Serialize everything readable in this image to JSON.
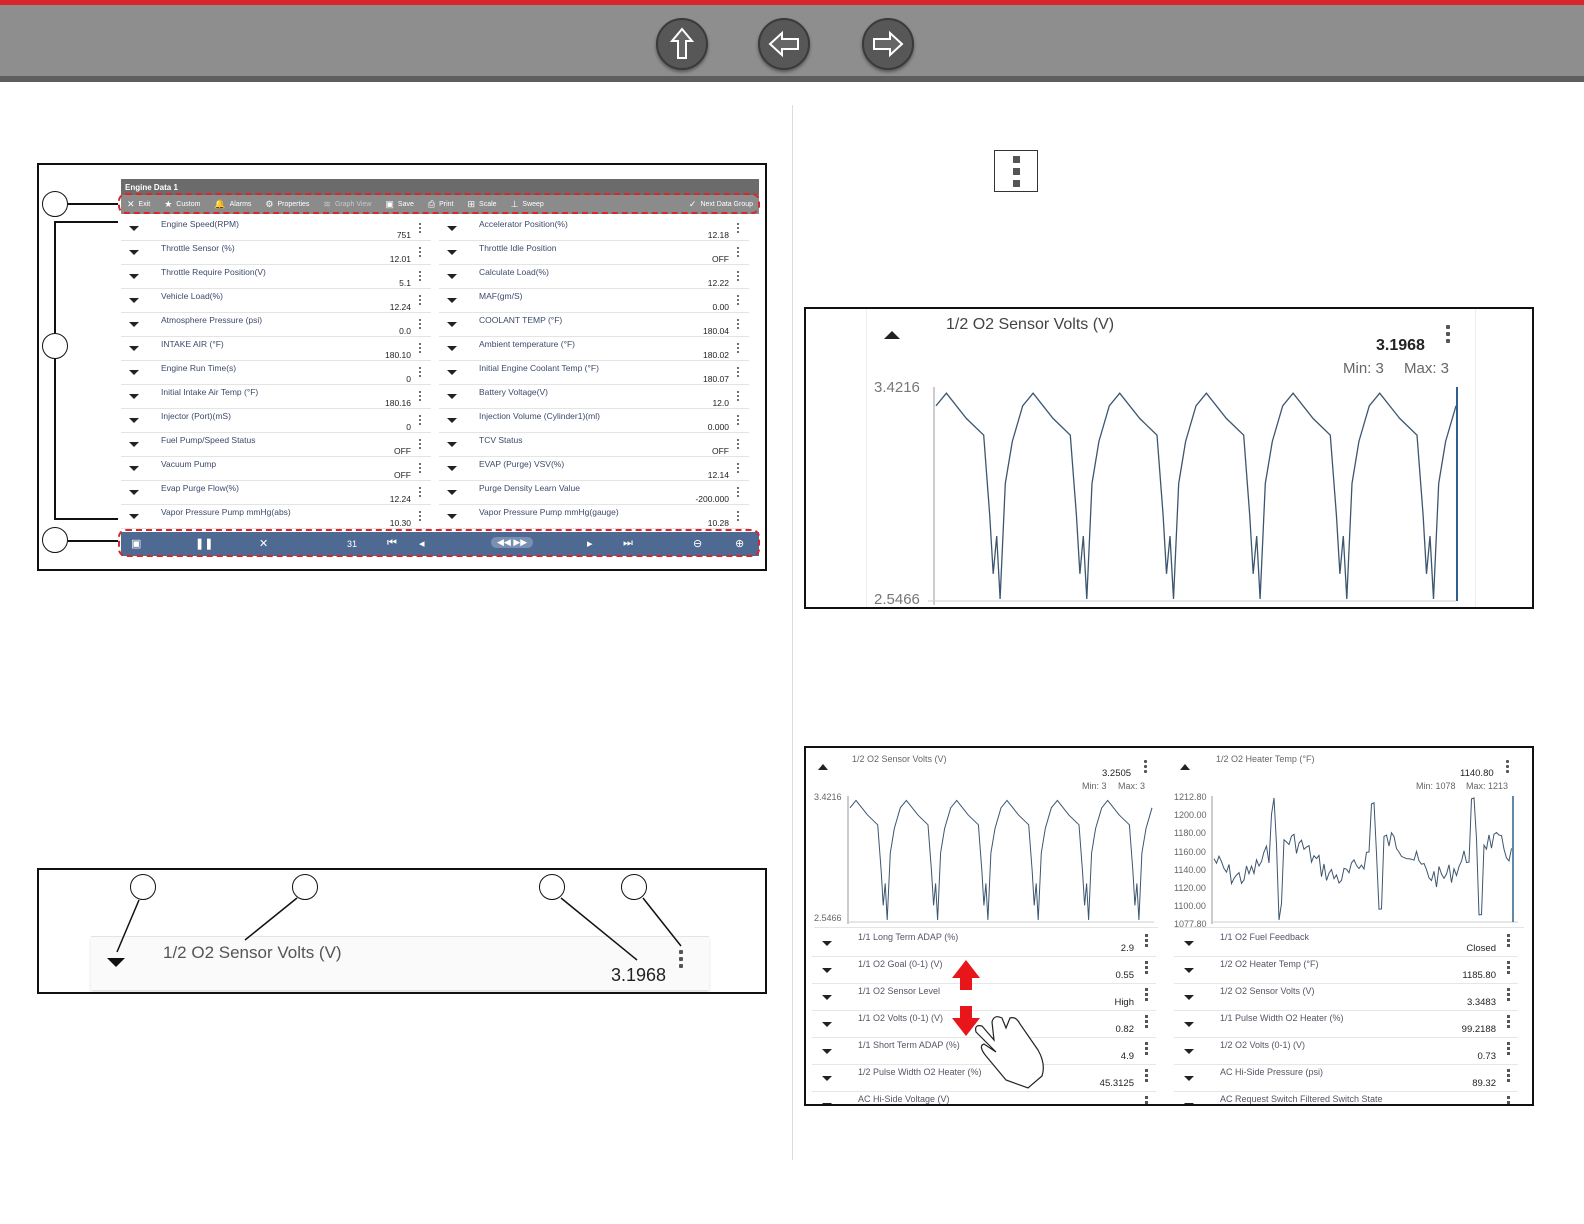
{
  "nav": {
    "home_icon": "up-arrow-icon",
    "back_icon": "left-arrow-icon",
    "forward_icon": "right-arrow-icon"
  },
  "fig1": {
    "window_title": "Engine Data 1",
    "toolbar": {
      "exit": "Exit",
      "custom": "Custom",
      "alarms": "Alarms",
      "properties": "Properties",
      "graph_view": "Graph View",
      "save": "Save",
      "print": "Print",
      "scale": "Scale",
      "sweep": "Sweep",
      "next_group": "Next Data Group"
    },
    "left": [
      {
        "name": "Engine Speed(RPM)",
        "value": "751"
      },
      {
        "name": "Throttle Sensor (%)",
        "value": "12.01"
      },
      {
        "name": "Throttle Require Position(V)",
        "value": "5.1"
      },
      {
        "name": "Vehicle Load(%)",
        "value": "12.24"
      },
      {
        "name": "Atmosphere Pressure (psi)",
        "value": "0.0"
      },
      {
        "name": "INTAKE AIR (°F)",
        "value": "180.10"
      },
      {
        "name": "Engine Run Time(s)",
        "value": "0"
      },
      {
        "name": "Initial Intake Air Temp (°F)",
        "value": "180.16"
      },
      {
        "name": "Injector (Port)(mS)",
        "value": "0"
      },
      {
        "name": "Fuel Pump/Speed Status",
        "value": "OFF"
      },
      {
        "name": "Vacuum Pump",
        "value": "OFF"
      },
      {
        "name": "Evap Purge Flow(%)",
        "value": "12.24"
      },
      {
        "name": "Vapor Pressure Pump mmHg(abs)",
        "value": "10.30"
      }
    ],
    "right": [
      {
        "name": "Accelerator Position(%)",
        "value": "12.18"
      },
      {
        "name": "Throttle Idle Position",
        "value": "OFF"
      },
      {
        "name": "Calculate Load(%)",
        "value": "12.22"
      },
      {
        "name": "MAF(gm/S)",
        "value": "0.00"
      },
      {
        "name": "COOLANT TEMP (°F)",
        "value": "180.04"
      },
      {
        "name": "Ambient temperature (°F)",
        "value": "180.02"
      },
      {
        "name": "Initial Engine Coolant Temp (°F)",
        "value": "180.07"
      },
      {
        "name": "Battery Voltage(V)",
        "value": "12.0"
      },
      {
        "name": "Injection Volume (Cylinder1)(ml)",
        "value": "0.000"
      },
      {
        "name": "TCV Status",
        "value": "OFF"
      },
      {
        "name": "EVAP (Purge) VSV(%)",
        "value": "12.14"
      },
      {
        "name": "Purge Density Learn Value",
        "value": "-200.000"
      },
      {
        "name": "Vapor Pressure Pump mmHg(gauge)",
        "value": "10.28"
      }
    ],
    "bottom": {
      "frame_count": "31"
    }
  },
  "fig2": {
    "title": "1/2 O2 Sensor Volts (V)",
    "value": "3.1968",
    "min": "Min: 3",
    "max": "Max: 3",
    "ymax": "3.4216",
    "ymin": "2.5466"
  },
  "fig3": {
    "title": "1/2 O2 Sensor Volts (V)",
    "value": "3.1968"
  },
  "fig4": {
    "graph_left": {
      "title": "1/2 O2 Sensor Volts (V)",
      "value": "3.2505",
      "min": "Min: 3",
      "max": "Max: 3",
      "ymax": "3.4216",
      "ymin": "2.5466"
    },
    "graph_right": {
      "title": "1/2 O2 Heater Temp (°F)",
      "value": "1140.80",
      "min": "Min: 1078",
      "max": "Max: 1213",
      "ticks": [
        "1212.80",
        "1200.00",
        "1180.00",
        "1160.00",
        "1140.00",
        "1120.00",
        "1100.00",
        "1077.80"
      ]
    },
    "left": [
      {
        "name": "1/1 Long Term ADAP (%)",
        "value": "2.9"
      },
      {
        "name": "1/1 O2 Goal (0-1) (V)",
        "value": "0.55"
      },
      {
        "name": "1/1 O2 Sensor Level",
        "value": "High"
      },
      {
        "name": "1/1 O2 Volts (0-1) (V)",
        "value": "0.82"
      },
      {
        "name": "1/1 Short Term ADAP (%)",
        "value": "4.9"
      },
      {
        "name": "1/2 Pulse Width O2 Heater (%)",
        "value": "45.3125"
      },
      {
        "name": "AC Hi-Side Voltage (V)",
        "value": ""
      }
    ],
    "right": [
      {
        "name": "1/1 O2 Fuel Feedback",
        "value": "Closed"
      },
      {
        "name": "1/2 O2 Heater Temp (°F)",
        "value": "1185.80"
      },
      {
        "name": "1/2 O2 Sensor Volts (V)",
        "value": "3.3483"
      },
      {
        "name": "1/1 Pulse Width O2 Heater (%)",
        "value": "99.2188"
      },
      {
        "name": "1/2 O2 Volts (0-1) (V)",
        "value": "0.73"
      },
      {
        "name": "AC Hi-Side Pressure (psi)",
        "value": "89.32"
      },
      {
        "name": "AC Request Switch Filtered Switch State",
        "value": ""
      }
    ]
  }
}
